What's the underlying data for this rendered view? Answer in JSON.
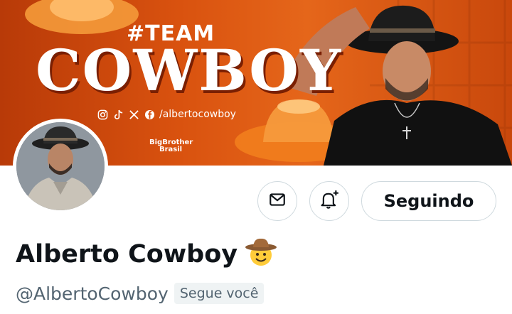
{
  "banner": {
    "team_text": "#TEAM",
    "cowboy_text": "COWBOY",
    "social_handle": "/albertocowboy",
    "social_icons": [
      "instagram-icon",
      "tiktok-icon",
      "x-icon",
      "facebook-icon"
    ],
    "show_logo_line1": "BigBrother",
    "show_logo_line2": "Brasil"
  },
  "profile": {
    "name": "Alberto Cowboy",
    "name_emoji": "🤠",
    "handle": "@AlbertoCowboy",
    "follows_you_label": "Segue você"
  },
  "actions": {
    "message_icon": "envelope-icon",
    "notify_icon": "bell-plus-icon",
    "follow_label": "Seguindo"
  },
  "colors": {
    "banner_orange": "#d9520f",
    "text_primary": "#0f1419",
    "text_secondary": "#536471",
    "border": "#cfd9de"
  }
}
